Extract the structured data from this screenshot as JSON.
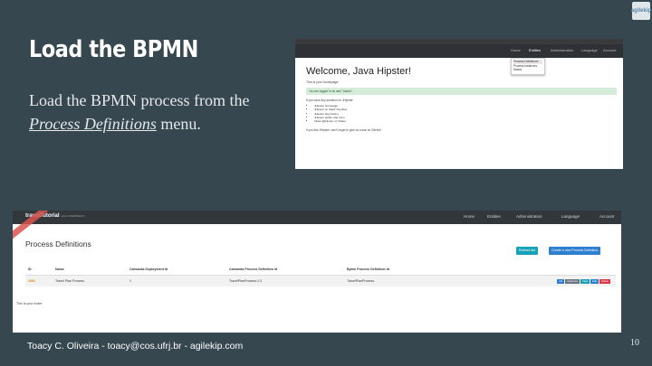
{
  "slide": {
    "title": "Load the BPMN",
    "body_prefix": "Load the BPMN process from the ",
    "body_emph": "Process Definitions",
    "body_suffix": " menu.",
    "footer": "Toacy C. Oliveira - toacy@cos.ufrj.br - agilekip.com",
    "page_number": "10",
    "logo_text": "agilekip"
  },
  "shot1": {
    "nav_items": [
      "Home",
      "Entities",
      "Administration",
      "Language",
      "Account"
    ],
    "dropdown": [
      "Process Definitions",
      "Process Instances",
      "Status"
    ],
    "welcome": "Welcome, Java Hipster!",
    "homepage": "This is your homepage",
    "alert": "You are logged in as user \"admin\".",
    "question": "If you have any question on JHipster:",
    "links": [
      "JHipster homepage",
      "JHipster on Stack Overflow",
      "JHipster bug tracker",
      "JHipster public chat room",
      "follow @jhipster on Twitter"
    ],
    "like": "If you like JHipster, don't forget to give us a star on GitHub!"
  },
  "shot2": {
    "brand": "travelTutorial",
    "brand_version": "v0.0.1-SNAPSHOT",
    "nav_items": [
      "Home",
      "Entities",
      "Administration",
      "Language",
      "Account"
    ],
    "page_title": "Process Definitions",
    "refresh_button": "Refresh list",
    "create_button": "Create a new Process Definition",
    "columns": [
      "ID",
      "Name",
      "Camunda Deployment Id",
      "Camunda Process Definition Id",
      "Bpmn Process Definition Id"
    ],
    "row": [
      "1001",
      "Travel Plan Process",
      "1",
      "TravelPlanProcess:1:3",
      "TravelPlanProcess"
    ],
    "actions": [
      "Init",
      "Instances",
      "View",
      "Edit",
      "Delete"
    ],
    "footer": "This is your footer"
  }
}
